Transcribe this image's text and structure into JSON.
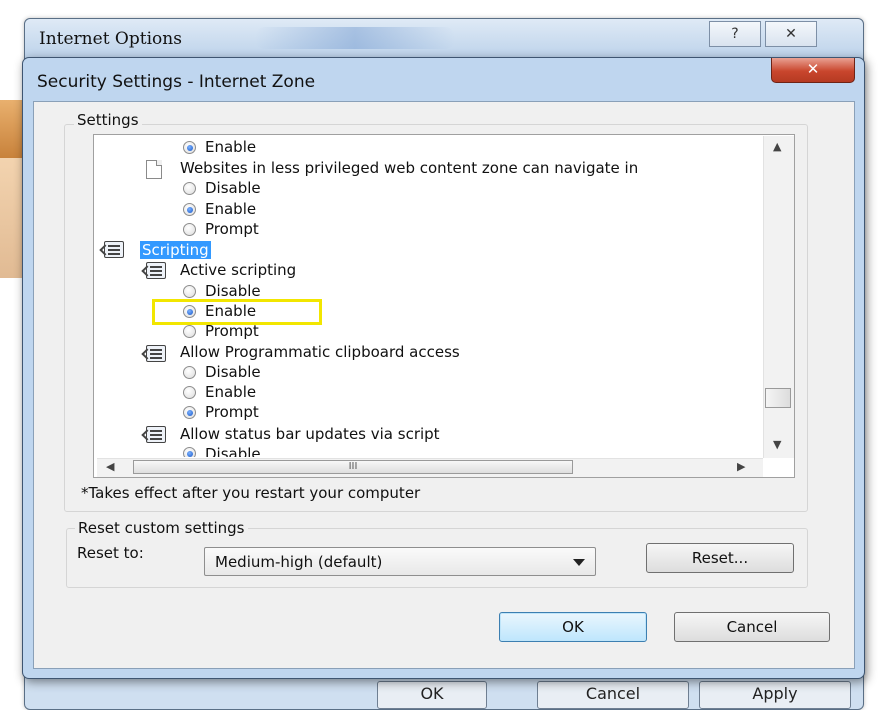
{
  "background_window": {
    "title": "Internet Options",
    "title_bar_buttons": {
      "help": "?",
      "close": "✕"
    },
    "bottom_buttons": [
      "OK",
      "Cancel",
      "Apply"
    ]
  },
  "dialog": {
    "title": "Security Settings - Internet Zone",
    "close_label": "✕",
    "settings_group_label": "Settings",
    "list": [
      {
        "kind": "radio",
        "label": "Enable",
        "checked": true
      },
      {
        "kind": "setting",
        "icon": "document-icon",
        "label": "Websites in less privileged web content zone can navigate in"
      },
      {
        "kind": "radio",
        "label": "Disable",
        "checked": false
      },
      {
        "kind": "radio",
        "label": "Enable",
        "checked": true
      },
      {
        "kind": "radio",
        "label": "Prompt",
        "checked": false
      },
      {
        "kind": "category",
        "icon": "script-icon",
        "label": "Scripting",
        "selected": true
      },
      {
        "kind": "setting",
        "icon": "script-icon",
        "label": "Active scripting"
      },
      {
        "kind": "radio",
        "label": "Disable",
        "checked": false
      },
      {
        "kind": "radio",
        "label": "Enable",
        "checked": true,
        "highlighted": true
      },
      {
        "kind": "radio",
        "label": "Prompt",
        "checked": false
      },
      {
        "kind": "setting",
        "icon": "script-icon",
        "label": "Allow Programmatic clipboard access"
      },
      {
        "kind": "radio",
        "label": "Disable",
        "checked": false
      },
      {
        "kind": "radio",
        "label": "Enable",
        "checked": false
      },
      {
        "kind": "radio",
        "label": "Prompt",
        "checked": true
      },
      {
        "kind": "setting",
        "icon": "script-icon",
        "label": "Allow status bar updates via script"
      },
      {
        "kind": "radio",
        "label": "Disable",
        "checked": true
      }
    ],
    "hscroll_grip": "III",
    "footnote": "*Takes effect after you restart your computer",
    "reset_group_label": "Reset custom settings",
    "reset_to_label": "Reset to:",
    "reset_to_value": "Medium-high (default)",
    "reset_button": "Reset...",
    "ok_button": "OK",
    "cancel_button": "Cancel"
  }
}
